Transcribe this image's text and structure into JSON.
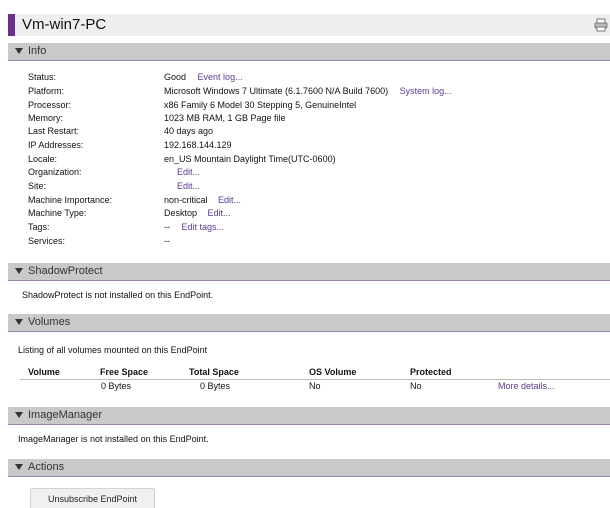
{
  "title": "Vm-win7-PC",
  "sections": {
    "info": "Info",
    "shadowprotect": "ShadowProtect",
    "volumes": "Volumes",
    "imagemanager": "ImageManager",
    "actions": "Actions"
  },
  "info": {
    "status": {
      "label": "Status:",
      "value": "Good",
      "link": "Event log..."
    },
    "platform": {
      "label": "Platform:",
      "value": "Microsoft Windows 7 Ultimate (6.1.7600 N/A Build 7600)",
      "link": "System log..."
    },
    "processor": {
      "label": "Processor:",
      "value": "x86 Family 6 Model 30 Stepping 5, GenuineIntel"
    },
    "memory": {
      "label": "Memory:",
      "value": "1023 MB RAM, 1 GB Page file"
    },
    "last_restart": {
      "label": "Last Restart:",
      "value": "40 days ago"
    },
    "ip": {
      "label": "IP Addresses:",
      "value": "192.168.144.129"
    },
    "locale": {
      "label": "Locale:",
      "value": "en_US Mountain Daylight Time(UTC-0600)"
    },
    "organization": {
      "label": "Organization:",
      "link": "Edit..."
    },
    "site": {
      "label": "Site:",
      "link": "Edit..."
    },
    "importance": {
      "label": "Machine Importance:",
      "value": "non-critical",
      "link": "Edit..."
    },
    "type": {
      "label": "Machine Type:",
      "value": "Desktop",
      "link": "Edit..."
    },
    "tags": {
      "label": "Tags:",
      "value": "--",
      "link": "Edit tags..."
    },
    "services": {
      "label": "Services:",
      "value": "--"
    }
  },
  "shadowprotect_message": "ShadowProtect is not installed on this EndPoint.",
  "volumes": {
    "intro": "Listing of all volumes mounted on this EndPoint",
    "columns": [
      "Volume",
      "Free Space",
      "Total Space",
      "OS Volume",
      "Protected"
    ],
    "rows": [
      {
        "volume": "",
        "free": "0 Bytes",
        "total": "0 Bytes",
        "os": "No",
        "protected": "No",
        "details": "More details..."
      }
    ]
  },
  "imagemanager_message": "ImageManager is not installed on this EndPoint.",
  "actions": {
    "unsubscribe_label": "Unsubscribe EndPoint"
  },
  "colors": {
    "accent": "#6a2f8e",
    "link": "#5b3b8c",
    "section_bg": "#c9c9c9",
    "title_bg": "#efefef"
  }
}
